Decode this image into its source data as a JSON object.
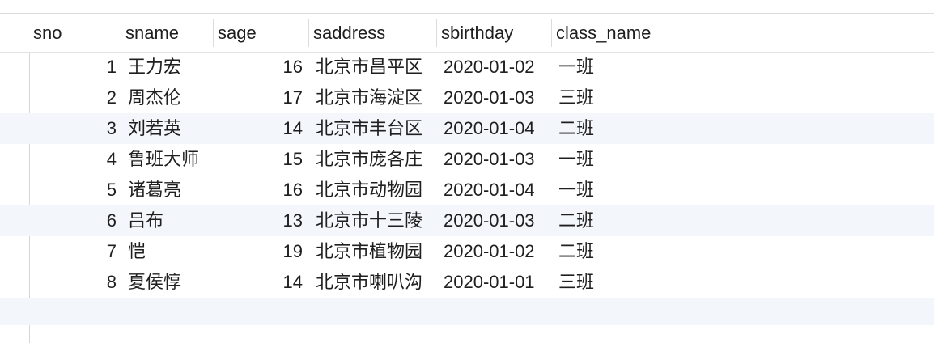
{
  "table": {
    "columns": [
      "sno",
      "sname",
      "sage",
      "saddress",
      "sbirthday",
      "class_name"
    ],
    "rows": [
      {
        "sno": "1",
        "sname": "王力宏",
        "sage": "16",
        "saddress": "北京市昌平区",
        "sbirthday": "2020-01-02",
        "class_name": "一班"
      },
      {
        "sno": "2",
        "sname": "周杰伦",
        "sage": "17",
        "saddress": "北京市海淀区",
        "sbirthday": "2020-01-03",
        "class_name": "三班"
      },
      {
        "sno": "3",
        "sname": "刘若英",
        "sage": "14",
        "saddress": "北京市丰台区",
        "sbirthday": "2020-01-04",
        "class_name": "二班"
      },
      {
        "sno": "4",
        "sname": "鲁班大师",
        "sage": "15",
        "saddress": "北京市庞各庄",
        "sbirthday": "2020-01-03",
        "class_name": "一班"
      },
      {
        "sno": "5",
        "sname": "诸葛亮",
        "sage": "16",
        "saddress": "北京市动物园",
        "sbirthday": "2020-01-04",
        "class_name": "一班"
      },
      {
        "sno": "6",
        "sname": "吕布",
        "sage": "13",
        "saddress": "北京市十三陵",
        "sbirthday": "2020-01-03",
        "class_name": "二班"
      },
      {
        "sno": "7",
        "sname": "恺",
        "sage": "19",
        "saddress": "北京市植物园",
        "sbirthday": "2020-01-02",
        "class_name": "二班"
      },
      {
        "sno": "8",
        "sname": "夏侯惇",
        "sage": "14",
        "saddress": "北京市喇叭沟",
        "sbirthday": "2020-01-01",
        "class_name": "三班"
      }
    ]
  },
  "colors": {
    "stripe": "#f3f6fb",
    "grid_line": "#dcdcdc",
    "text": "#1f1f1f"
  }
}
